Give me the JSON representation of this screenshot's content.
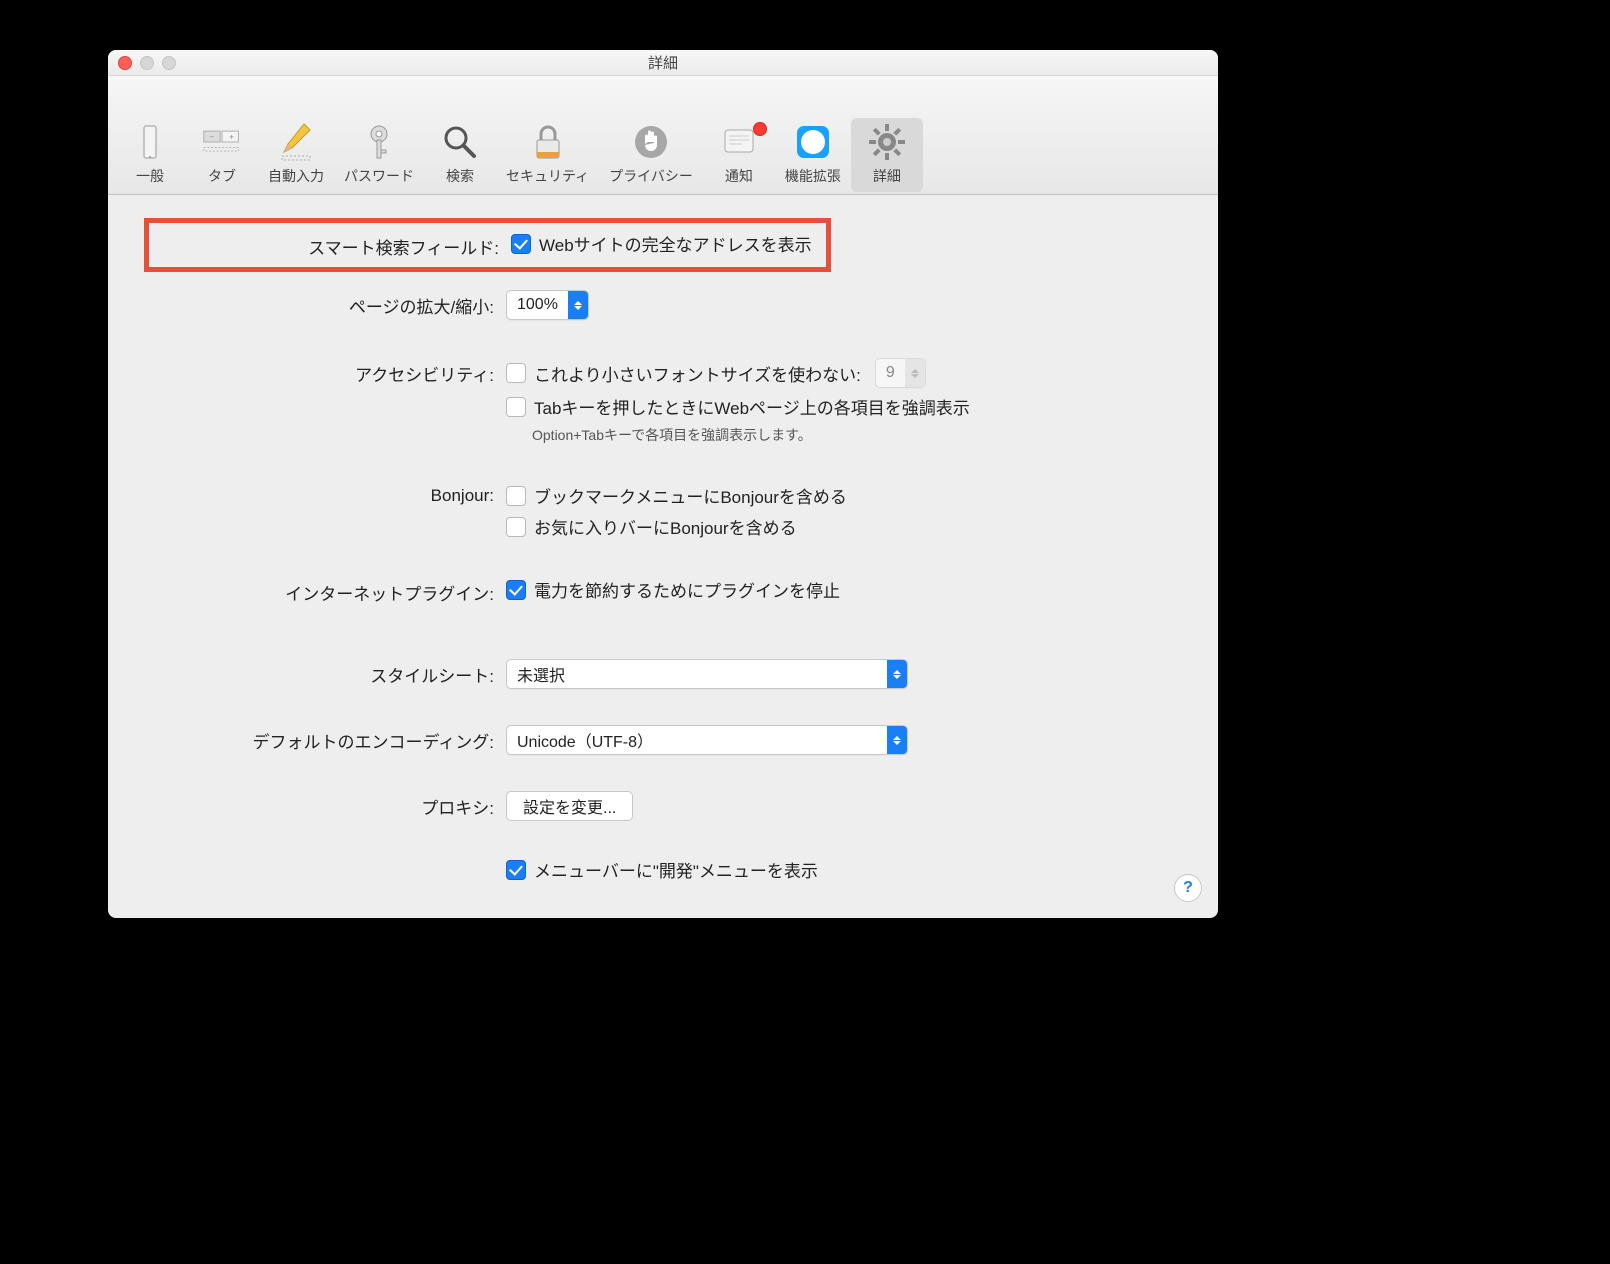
{
  "window": {
    "title": "詳細"
  },
  "toolbar": {
    "general": "一般",
    "tabs": "タブ",
    "autofill": "自動入力",
    "passwords": "パスワード",
    "search": "検索",
    "security": "セキュリティ",
    "privacy": "プライバシー",
    "notifications": "通知",
    "extensions": "機能拡張",
    "advanced": "詳細"
  },
  "labels": {
    "smartSearch": "スマート検索フィールド:",
    "zoom": "ページの拡大/縮小:",
    "accessibility": "アクセシビリティ:",
    "bonjour": "Bonjour:",
    "plugins": "インターネットプラグイン:",
    "stylesheet": "スタイルシート:",
    "encoding": "デフォルトのエンコーディング:",
    "proxy": "プロキシ:"
  },
  "opts": {
    "smartSearch_showFullUrl": "Webサイトの完全なアドレスを表示",
    "zoom_value": "100%",
    "a11y_noSmallFont": "これより小さいフォントサイズを使わない:",
    "a11y_fontSize": "9",
    "a11y_tabHighlight": "Tabキーを押したときにWebページ上の各項目を強調表示",
    "a11y_hint": "Option+Tabキーで各項目を強調表示します。",
    "bonjour_bookmarks": "ブックマークメニューにBonjourを含める",
    "bonjour_favorites": "お気に入りバーにBonjourを含める",
    "plugins_powerSave": "電力を節約するためにプラグインを停止",
    "stylesheet_value": "未選択",
    "encoding_value": "Unicode（UTF-8）",
    "proxy_button": "設定を変更...",
    "develop_menu": "メニューバーに\"開発\"メニューを表示"
  },
  "help": "?"
}
